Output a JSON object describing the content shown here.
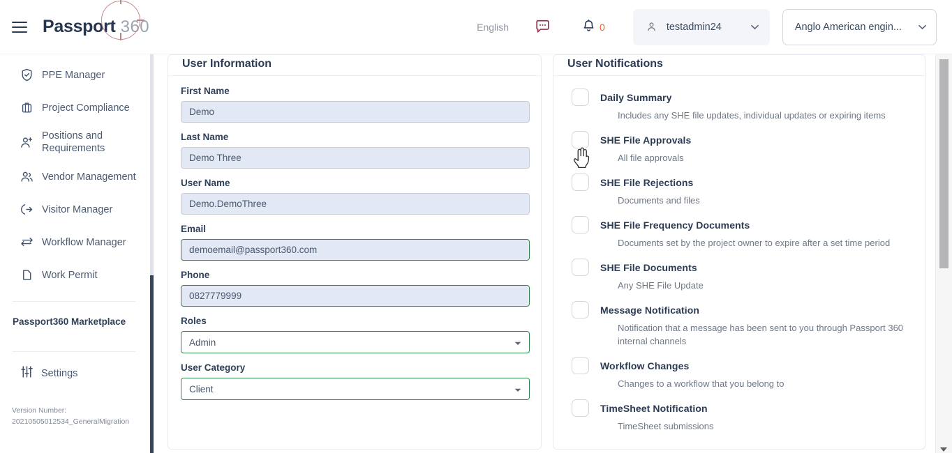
{
  "header": {
    "menu_icon": "hamburger-icon",
    "brand_main": "Passport",
    "brand_sub": "360",
    "language": "English",
    "message_icon": "message-bubble-icon",
    "bell_icon": "bell-icon",
    "notification_count": "0",
    "user_icon": "user-icon",
    "user_name": "testadmin24",
    "user_caret_icon": "chevron-down-icon",
    "org_name": "Anglo American engin...",
    "org_caret_icon": "chevron-down-icon",
    "colors": {
      "brand_navy": "#26374f",
      "brand_ring": "#c9868b",
      "message_red": "#9e2f4d",
      "badge_orange": "#e2642c"
    }
  },
  "sidebar": {
    "items": [
      {
        "label": "PPE Manager",
        "icon": "shield-check-icon"
      },
      {
        "label": "Project Compliance",
        "icon": "briefcase-icon"
      },
      {
        "label": "Positions and Requirements",
        "icon": "user-plus-icon"
      },
      {
        "label": "Vendor Management",
        "icon": "users-icon"
      },
      {
        "label": "Visitor Manager",
        "icon": "login-arrow-icon"
      },
      {
        "label": "Workflow Manager",
        "icon": "exchange-arrows-icon"
      },
      {
        "label": "Work Permit",
        "icon": "document-icon"
      }
    ],
    "marketplace_label": "Passport360 Marketplace",
    "settings_label": "Settings",
    "settings_icon": "sliders-icon",
    "version_label": "Version Number:",
    "version_value": "20210505012534_GeneralMigration"
  },
  "user_information": {
    "title": "User Information",
    "fields": [
      {
        "label": "First Name",
        "value": "Demo",
        "state": "readonly",
        "type": "text"
      },
      {
        "label": "Last Name",
        "value": "Demo Three",
        "state": "readonly",
        "type": "text"
      },
      {
        "label": "User Name",
        "value": "Demo.DemoThree",
        "state": "readonly",
        "type": "text"
      },
      {
        "label": "Email",
        "value": "demoemail@passport360.com",
        "state": "valid",
        "type": "text"
      },
      {
        "label": "Phone",
        "value": "0827779999",
        "state": "valid",
        "type": "text"
      },
      {
        "label": "Roles",
        "value": "Admin",
        "state": "valid",
        "type": "select"
      },
      {
        "label": "User Category",
        "value": "Client",
        "state": "valid",
        "type": "select"
      }
    ]
  },
  "user_notifications": {
    "title": "User Notifications",
    "items": [
      {
        "label": "Daily Summary",
        "desc": "Includes any SHE file updates, individual updates or expiring items",
        "checked": false
      },
      {
        "label": "SHE File Approvals",
        "desc": "All file approvals",
        "checked": false
      },
      {
        "label": "SHE File Rejections",
        "desc": "Documents and files",
        "checked": false
      },
      {
        "label": "SHE File Frequency Documents",
        "desc": "Documents set by the project owner to expire after a set time period",
        "checked": false
      },
      {
        "label": "SHE File Documents",
        "desc": "Any SHE File Update",
        "checked": false
      },
      {
        "label": "Message Notification",
        "desc": "Notification that a message has been sent to you through Passport 360 internal channels",
        "checked": false
      },
      {
        "label": "Workflow Changes",
        "desc": "Changes to a workflow that you belong to",
        "checked": false
      },
      {
        "label": "TimeSheet Notification",
        "desc": "TimeSheet submissions",
        "checked": false
      }
    ]
  },
  "scrollbars": {
    "sidebar_icon": "sidebar-scrollbar",
    "page_icon": "page-scrollbar",
    "page_arrow_icon": "chevron-down-icon"
  },
  "cursor": {
    "icon": "pointing-hand-cursor"
  }
}
